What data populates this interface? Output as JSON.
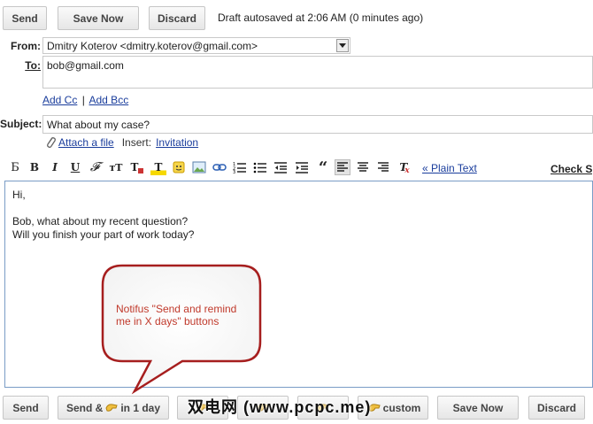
{
  "toolbar_top": {
    "send": "Send",
    "save_now": "Save Now",
    "discard": "Discard",
    "status": "Draft autosaved at 2:06 AM (0 minutes ago)"
  },
  "header": {
    "from_label": "From:",
    "from_value": "Dmitry Koterov <dmitry.koterov@gmail.com>",
    "to_label": "To:",
    "to_value": "bob@gmail.com",
    "add_cc": "Add Cc",
    "separator": "|",
    "add_bcc": "Add Bcc",
    "subject_label": "Subject:",
    "subject_value": "What about my case?",
    "attach": "Attach a file",
    "insert_label": "Insert:",
    "invitation": "Invitation"
  },
  "format_toolbar": {
    "plain_text": "« Plain Text",
    "check_spelling": "Check Sp"
  },
  "body": {
    "lines": [
      "Hi,",
      "",
      "Bob, what about my recent question?",
      "Will you finish your part of work today?"
    ]
  },
  "callout": {
    "text": "Notifus \"Send and remind me in X days\" buttons",
    "color": "#c0392b"
  },
  "toolbar_bottom": {
    "send": "Send",
    "send_and": "Send &",
    "in_1_day": "in 1 day",
    "custom": "custom",
    "save_now": "Save Now",
    "discard": "Discard"
  },
  "watermark": "双电网 (www.pcpc.me)"
}
